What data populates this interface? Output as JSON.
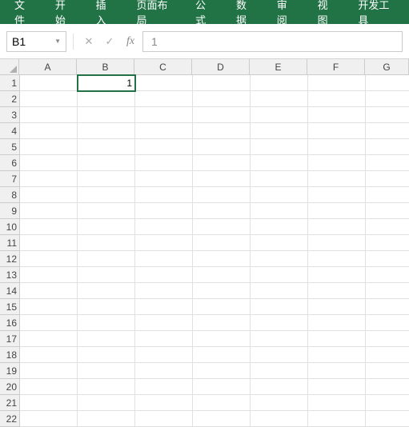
{
  "ribbon": {
    "tabs": [
      "文件",
      "开始",
      "插入",
      "页面布局",
      "公式",
      "数据",
      "审阅",
      "视图",
      "开发工具"
    ]
  },
  "formulaBar": {
    "nameBox": "B1",
    "fxLabel": "fx",
    "formula": "1"
  },
  "grid": {
    "columns": [
      "A",
      "B",
      "C",
      "D",
      "E",
      "F",
      "G"
    ],
    "rowCount": 22,
    "selected": {
      "row": 1,
      "col": "B"
    },
    "cells": {
      "B1": "1"
    }
  }
}
